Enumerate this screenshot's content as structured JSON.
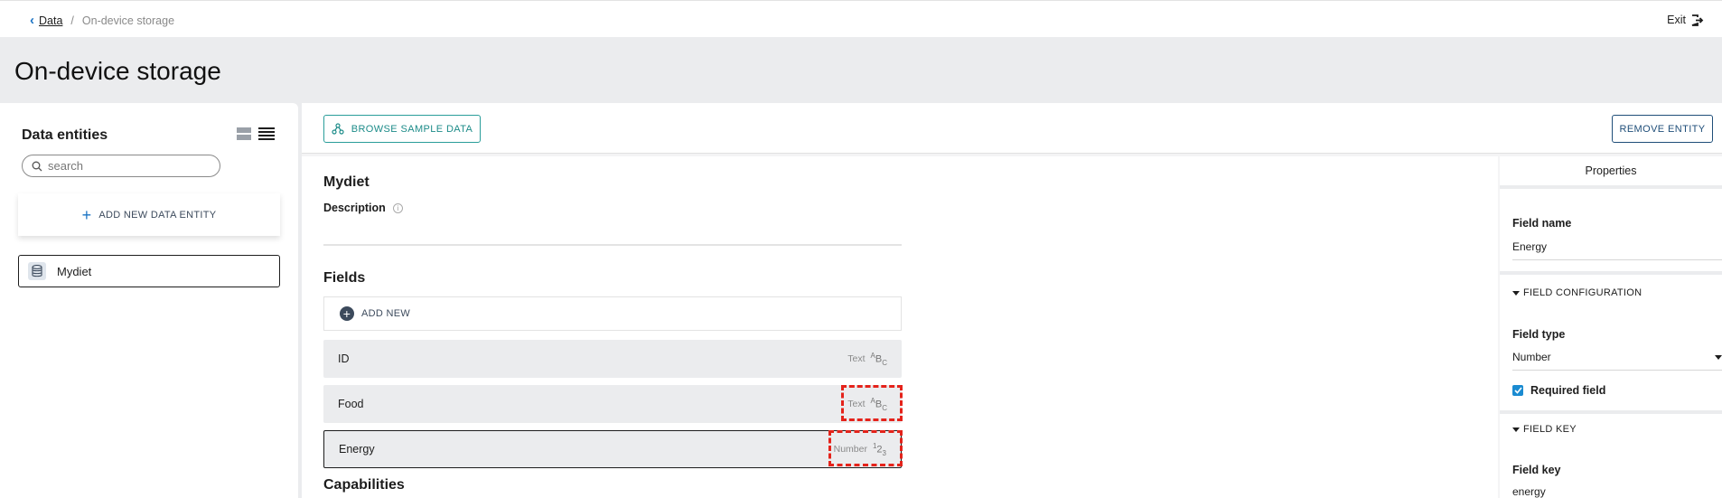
{
  "breadcrumb": {
    "parent": "Data",
    "separator": "/",
    "current": "On-device storage"
  },
  "header": {
    "exit_label": "Exit"
  },
  "page_title": "On-device storage",
  "sidebar": {
    "title": "Data entities",
    "search_placeholder": "search",
    "add_entity_label": "ADD NEW DATA ENTITY",
    "entities": [
      {
        "name": "Mydiet",
        "icon": "database-icon"
      }
    ]
  },
  "toolbar": {
    "browse_label": "BROWSE SAMPLE DATA",
    "remove_label": "REMOVE ENTITY"
  },
  "entity": {
    "name": "Mydiet",
    "description_label": "Description",
    "fields_heading": "Fields",
    "add_new_label": "ADD NEW",
    "fields": [
      {
        "name": "ID",
        "type": "Text",
        "glyph_a": "A",
        "glyph_b": "B",
        "glyph_c": "C"
      },
      {
        "name": "Food",
        "type": "Text",
        "glyph_a": "A",
        "glyph_b": "B",
        "glyph_c": "C"
      },
      {
        "name": "Energy",
        "type": "Number",
        "glyph_a": "1",
        "glyph_b": "2",
        "glyph_c": "3"
      }
    ],
    "capabilities_heading": "Capabilities"
  },
  "properties": {
    "title": "Properties",
    "field_name_label": "Field name",
    "field_name_value": "Energy",
    "field_config_label": "FIELD CONFIGURATION",
    "field_type_label": "Field type",
    "field_type_value": "Number",
    "required_label": "Required field",
    "required_checked": true,
    "field_key_section": "FIELD KEY",
    "field_key_label": "Field key",
    "field_key_value": "energy"
  },
  "colors": {
    "accent": "#1a73c4",
    "teal": "#2a9d9a",
    "highlight": "#e4231b"
  }
}
